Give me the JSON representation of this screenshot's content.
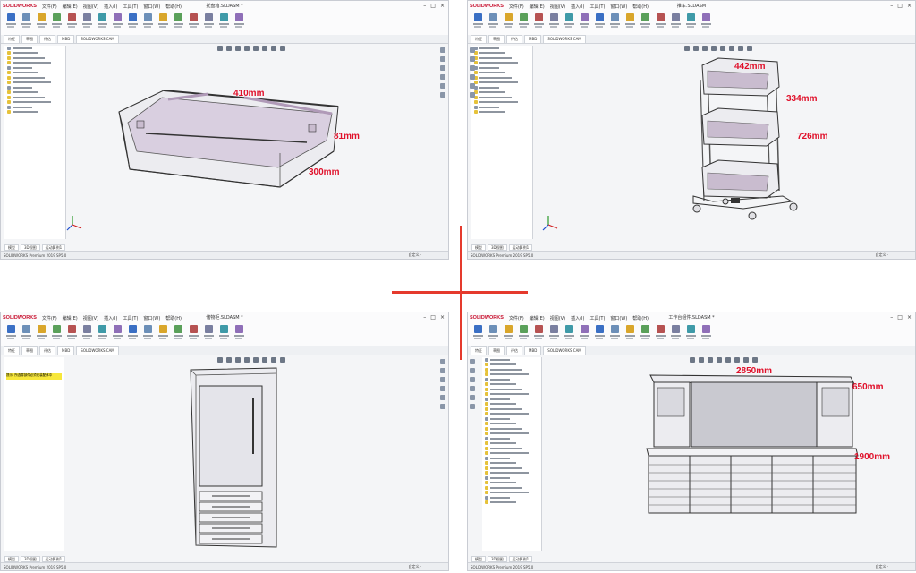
{
  "app": {
    "logo": "SOLIDWORKS",
    "status_left": "SOLIDWORKS Premium 2019 SP5.0",
    "status_right": "自定义 ·",
    "menus": [
      "文件(F)",
      "编辑(E)",
      "视图(V)",
      "插入(I)",
      "工具(T)",
      "窗口(W)",
      "帮助(H)"
    ],
    "tabs": [
      "特征",
      "草图",
      "评估",
      "MBD",
      "SOLIDWORKS CAM"
    ],
    "bottom_tabs": [
      "模型",
      "3D视图",
      "运动算例1"
    ]
  },
  "quadrants": [
    {
      "id": "tray",
      "title": "托盘箱.SLDASM *",
      "dimensions": [
        "410mm",
        "81mm",
        "300mm"
      ]
    },
    {
      "id": "cart",
      "title": "推车.SLDASM",
      "dimensions": [
        "442mm",
        "334mm",
        "726mm"
      ]
    },
    {
      "id": "cabinet",
      "title": "储物柜.SLDASM *",
      "panel_warning": "提示: 所选零部件必须在装配体中",
      "dimensions": []
    },
    {
      "id": "workbench",
      "title": "工作台组件.SLDASM *",
      "dimensions": [
        "2850mm",
        "650mm",
        "1900mm"
      ]
    }
  ],
  "colors": {
    "dimension": "#e0102a",
    "cross": "#e53a2d",
    "model_fill": "#ececf0",
    "model_shade": "#c9bccf"
  }
}
